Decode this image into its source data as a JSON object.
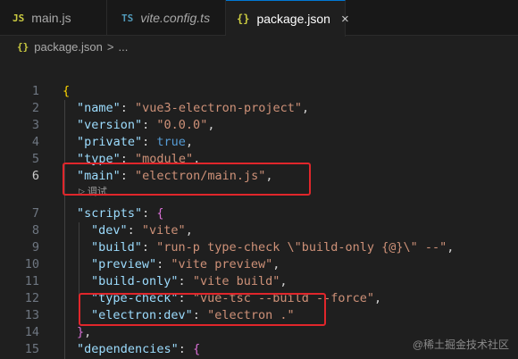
{
  "tabs": [
    {
      "icon": "JS",
      "label": "main.js"
    },
    {
      "icon": "TS",
      "label": "vite.config.ts"
    },
    {
      "icon": "{}",
      "label": "package.json",
      "close": "×"
    }
  ],
  "breadcrumb": {
    "icon": "{}",
    "file": "package.json",
    "sep": ">",
    "more": "..."
  },
  "editor": {
    "current_line": 6,
    "lines": [
      {
        "n": "1",
        "tokens": [
          [
            "br1",
            "{"
          ]
        ]
      },
      {
        "n": "2",
        "tokens": [
          [
            "k",
            "\"name\""
          ],
          [
            "p",
            ": "
          ],
          [
            "s",
            "\"vue3-electron-project\""
          ],
          [
            "p",
            ","
          ]
        ]
      },
      {
        "n": "3",
        "tokens": [
          [
            "k",
            "\"version\""
          ],
          [
            "p",
            ": "
          ],
          [
            "s",
            "\"0.0.0\""
          ],
          [
            "p",
            ","
          ]
        ]
      },
      {
        "n": "4",
        "tokens": [
          [
            "k",
            "\"private\""
          ],
          [
            "p",
            ": "
          ],
          [
            "b",
            "true"
          ],
          [
            "p",
            ","
          ]
        ]
      },
      {
        "n": "5",
        "tokens": [
          [
            "k",
            "\"type\""
          ],
          [
            "p",
            ": "
          ],
          [
            "s",
            "\"module\""
          ],
          [
            "p",
            ","
          ]
        ]
      },
      {
        "n": "6",
        "tokens": [
          [
            "k",
            "\"main\""
          ],
          [
            "p",
            ": "
          ],
          [
            "s",
            "\"electron/main.js\""
          ],
          [
            "p",
            ","
          ]
        ]
      },
      {
        "n": "7",
        "tokens": [
          [
            "k",
            "\"scripts\""
          ],
          [
            "p",
            ": "
          ],
          [
            "br2",
            "{"
          ]
        ]
      },
      {
        "n": "8",
        "tokens": [
          [
            "k",
            "\"dev\""
          ],
          [
            "p",
            ": "
          ],
          [
            "s",
            "\"vite\""
          ],
          [
            "p",
            ","
          ]
        ]
      },
      {
        "n": "9",
        "tokens": [
          [
            "k",
            "\"build\""
          ],
          [
            "p",
            ": "
          ],
          [
            "s",
            "\"run-p type-check \\\"build-only {@}\\\" --\""
          ],
          [
            "p",
            ","
          ]
        ]
      },
      {
        "n": "10",
        "tokens": [
          [
            "k",
            "\"preview\""
          ],
          [
            "p",
            ": "
          ],
          [
            "s",
            "\"vite preview\""
          ],
          [
            "p",
            ","
          ]
        ]
      },
      {
        "n": "11",
        "tokens": [
          [
            "k",
            "\"build-only\""
          ],
          [
            "p",
            ": "
          ],
          [
            "s",
            "\"vite build\""
          ],
          [
            "p",
            ","
          ]
        ]
      },
      {
        "n": "12",
        "tokens": [
          [
            "k",
            "\"type-check\""
          ],
          [
            "p",
            ": "
          ],
          [
            "s",
            "\"vue-tsc --build --force\""
          ],
          [
            "p",
            ","
          ]
        ]
      },
      {
        "n": "13",
        "tokens": [
          [
            "k",
            "\"electron:dev\""
          ],
          [
            "p",
            ": "
          ],
          [
            "s",
            "\"electron .\""
          ]
        ]
      },
      {
        "n": "14",
        "tokens": [
          [
            "br2",
            "}"
          ],
          [
            "p",
            ","
          ]
        ]
      },
      {
        "n": "15",
        "tokens": [
          [
            "k",
            "\"dependencies\""
          ],
          [
            "p",
            ": "
          ],
          [
            "br2",
            "{"
          ]
        ]
      }
    ],
    "codelens": "调试"
  },
  "watermark": "@稀土掘金技术社区",
  "colors": {
    "highlight_box": "#e0262b",
    "accent": "#0078d4"
  }
}
